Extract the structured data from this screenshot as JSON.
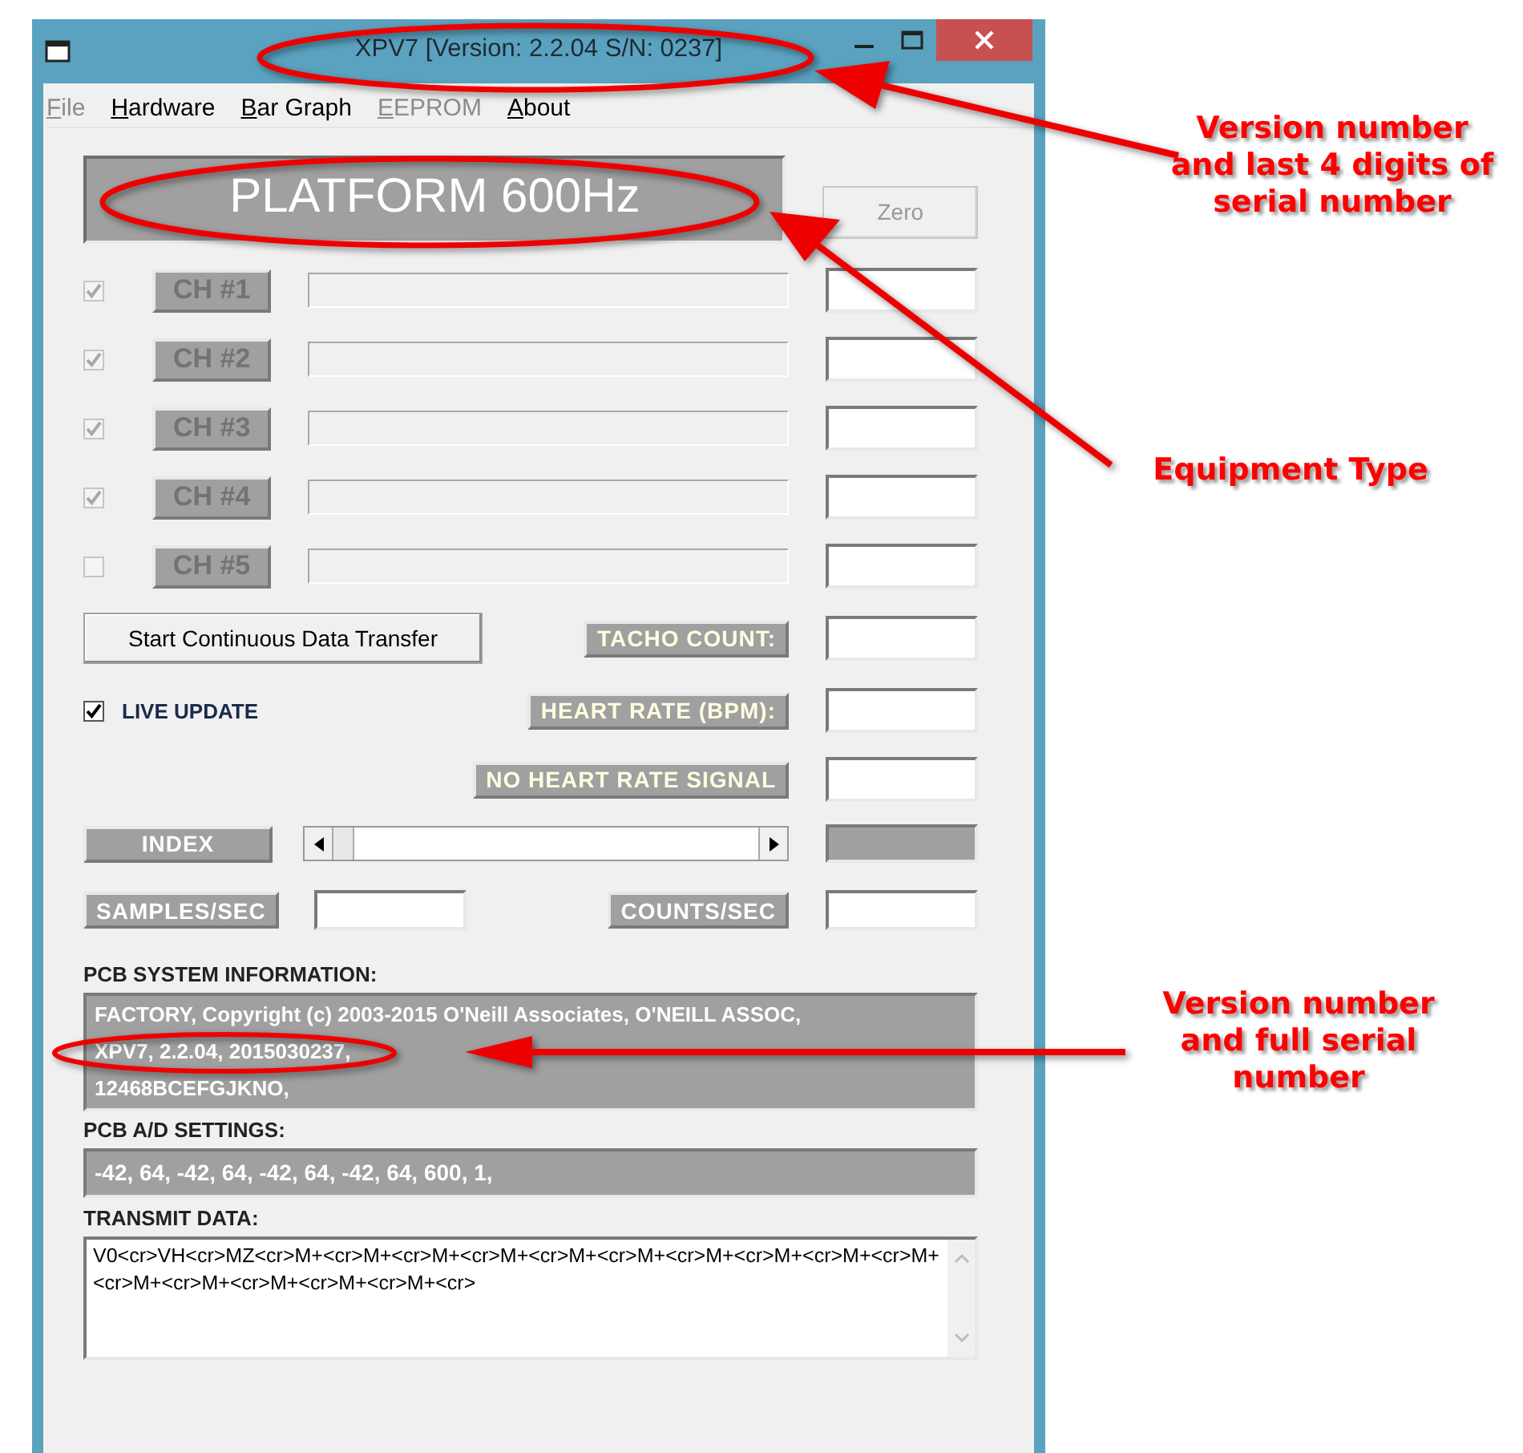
{
  "window": {
    "title": "XPV7 [Version: 2.2.04 S/N: 0237]"
  },
  "menu": [
    {
      "label": "File",
      "disabled": true
    },
    {
      "label": "Hardware",
      "disabled": false
    },
    {
      "label": "Bar Graph",
      "disabled": false
    },
    {
      "label": "EEPROM",
      "disabled": true
    },
    {
      "label": "About",
      "disabled": false
    }
  ],
  "equipment_type": "PLATFORM 600Hz",
  "zero_button": {
    "label": "Zero",
    "disabled": true
  },
  "channels": [
    {
      "label": "CH #1",
      "checked": true
    },
    {
      "label": "CH #2",
      "checked": true
    },
    {
      "label": "CH #3",
      "checked": true
    },
    {
      "label": "CH #4",
      "checked": true
    },
    {
      "label": "CH #5",
      "checked": false
    }
  ],
  "start_button": "Start Continuous Data Transfer",
  "live_update": {
    "label": "LIVE UPDATE",
    "checked": true
  },
  "readouts": [
    {
      "label": "TACHO COUNT:"
    },
    {
      "label": "HEART RATE (BPM):"
    },
    {
      "label": "NO HEART RATE SIGNAL"
    }
  ],
  "index_label": "INDEX",
  "samples_label": "SAMPLES/SEC",
  "counts_label": "COUNTS/SEC",
  "system_info": {
    "label": "PCB SYSTEM INFORMATION:",
    "lines": [
      "FACTORY, Copyright (c) 2003-2015 O'Neill Associates, O'NEILL ASSOC,",
      "XPV7, 2.2.04, 2015030237,",
      "12468BCEFGJKNO,"
    ]
  },
  "ad_settings": {
    "label": "PCB A/D SETTINGS:",
    "value": "-42, 64, -42, 64, -42, 64, -42, 64, 600, 1,"
  },
  "transmit": {
    "label": "TRANSMIT DATA:",
    "value": "V0<cr>VH<cr>MZ<cr>M+<cr>M+<cr>M+<cr>M+<cr>M+<cr>M+<cr>M+<cr>M+<cr>M+<cr>M+<cr>M+<cr>M+<cr>M+<cr>M+<cr>M+<cr>"
  },
  "annotations": [
    {
      "text": "Version number\nand last 4 digits of\nserial number"
    },
    {
      "text": "Equipment Type"
    },
    {
      "text": "Version number\nand full serial\nnumber"
    }
  ]
}
